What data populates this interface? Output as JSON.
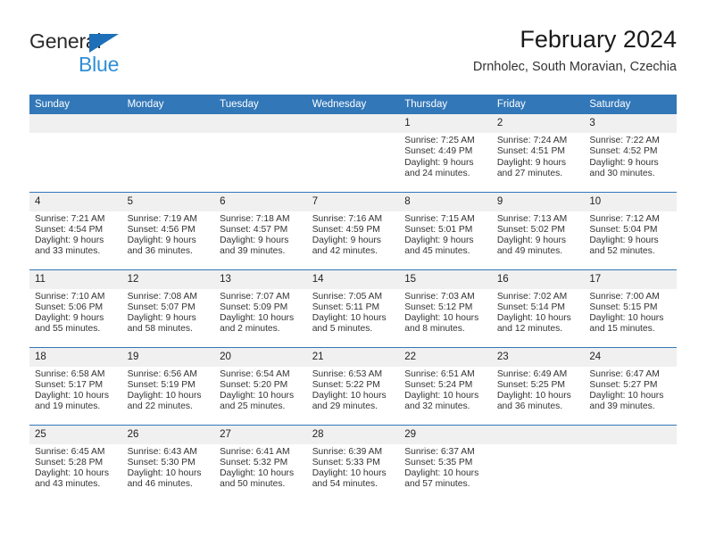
{
  "brand": {
    "name_top": "General",
    "name_bottom": "Blue",
    "triangle_color": "#1d6fb8",
    "text_top_color": "#2b2b2b",
    "text_bottom_color": "#2f8fd8"
  },
  "header": {
    "title": "February 2024",
    "subtitle": "Drnholec, South Moravian, Czechia"
  },
  "theme": {
    "header_blue": "#3277b8",
    "daynum_band": "#f0f0f0",
    "body_text": "#333333"
  },
  "weekdays": [
    "Sunday",
    "Monday",
    "Tuesday",
    "Wednesday",
    "Thursday",
    "Friday",
    "Saturday"
  ],
  "weeks": [
    [
      {
        "day": "",
        "sunrise": "",
        "sunset": "",
        "daylight_line1": "",
        "daylight_line2": ""
      },
      {
        "day": "",
        "sunrise": "",
        "sunset": "",
        "daylight_line1": "",
        "daylight_line2": ""
      },
      {
        "day": "",
        "sunrise": "",
        "sunset": "",
        "daylight_line1": "",
        "daylight_line2": ""
      },
      {
        "day": "",
        "sunrise": "",
        "sunset": "",
        "daylight_line1": "",
        "daylight_line2": ""
      },
      {
        "day": "1",
        "sunrise": "Sunrise: 7:25 AM",
        "sunset": "Sunset: 4:49 PM",
        "daylight_line1": "Daylight: 9 hours",
        "daylight_line2": "and 24 minutes."
      },
      {
        "day": "2",
        "sunrise": "Sunrise: 7:24 AM",
        "sunset": "Sunset: 4:51 PM",
        "daylight_line1": "Daylight: 9 hours",
        "daylight_line2": "and 27 minutes."
      },
      {
        "day": "3",
        "sunrise": "Sunrise: 7:22 AM",
        "sunset": "Sunset: 4:52 PM",
        "daylight_line1": "Daylight: 9 hours",
        "daylight_line2": "and 30 minutes."
      }
    ],
    [
      {
        "day": "4",
        "sunrise": "Sunrise: 7:21 AM",
        "sunset": "Sunset: 4:54 PM",
        "daylight_line1": "Daylight: 9 hours",
        "daylight_line2": "and 33 minutes."
      },
      {
        "day": "5",
        "sunrise": "Sunrise: 7:19 AM",
        "sunset": "Sunset: 4:56 PM",
        "daylight_line1": "Daylight: 9 hours",
        "daylight_line2": "and 36 minutes."
      },
      {
        "day": "6",
        "sunrise": "Sunrise: 7:18 AM",
        "sunset": "Sunset: 4:57 PM",
        "daylight_line1": "Daylight: 9 hours",
        "daylight_line2": "and 39 minutes."
      },
      {
        "day": "7",
        "sunrise": "Sunrise: 7:16 AM",
        "sunset": "Sunset: 4:59 PM",
        "daylight_line1": "Daylight: 9 hours",
        "daylight_line2": "and 42 minutes."
      },
      {
        "day": "8",
        "sunrise": "Sunrise: 7:15 AM",
        "sunset": "Sunset: 5:01 PM",
        "daylight_line1": "Daylight: 9 hours",
        "daylight_line2": "and 45 minutes."
      },
      {
        "day": "9",
        "sunrise": "Sunrise: 7:13 AM",
        "sunset": "Sunset: 5:02 PM",
        "daylight_line1": "Daylight: 9 hours",
        "daylight_line2": "and 49 minutes."
      },
      {
        "day": "10",
        "sunrise": "Sunrise: 7:12 AM",
        "sunset": "Sunset: 5:04 PM",
        "daylight_line1": "Daylight: 9 hours",
        "daylight_line2": "and 52 minutes."
      }
    ],
    [
      {
        "day": "11",
        "sunrise": "Sunrise: 7:10 AM",
        "sunset": "Sunset: 5:06 PM",
        "daylight_line1": "Daylight: 9 hours",
        "daylight_line2": "and 55 minutes."
      },
      {
        "day": "12",
        "sunrise": "Sunrise: 7:08 AM",
        "sunset": "Sunset: 5:07 PM",
        "daylight_line1": "Daylight: 9 hours",
        "daylight_line2": "and 58 minutes."
      },
      {
        "day": "13",
        "sunrise": "Sunrise: 7:07 AM",
        "sunset": "Sunset: 5:09 PM",
        "daylight_line1": "Daylight: 10 hours",
        "daylight_line2": "and 2 minutes."
      },
      {
        "day": "14",
        "sunrise": "Sunrise: 7:05 AM",
        "sunset": "Sunset: 5:11 PM",
        "daylight_line1": "Daylight: 10 hours",
        "daylight_line2": "and 5 minutes."
      },
      {
        "day": "15",
        "sunrise": "Sunrise: 7:03 AM",
        "sunset": "Sunset: 5:12 PM",
        "daylight_line1": "Daylight: 10 hours",
        "daylight_line2": "and 8 minutes."
      },
      {
        "day": "16",
        "sunrise": "Sunrise: 7:02 AM",
        "sunset": "Sunset: 5:14 PM",
        "daylight_line1": "Daylight: 10 hours",
        "daylight_line2": "and 12 minutes."
      },
      {
        "day": "17",
        "sunrise": "Sunrise: 7:00 AM",
        "sunset": "Sunset: 5:15 PM",
        "daylight_line1": "Daylight: 10 hours",
        "daylight_line2": "and 15 minutes."
      }
    ],
    [
      {
        "day": "18",
        "sunrise": "Sunrise: 6:58 AM",
        "sunset": "Sunset: 5:17 PM",
        "daylight_line1": "Daylight: 10 hours",
        "daylight_line2": "and 19 minutes."
      },
      {
        "day": "19",
        "sunrise": "Sunrise: 6:56 AM",
        "sunset": "Sunset: 5:19 PM",
        "daylight_line1": "Daylight: 10 hours",
        "daylight_line2": "and 22 minutes."
      },
      {
        "day": "20",
        "sunrise": "Sunrise: 6:54 AM",
        "sunset": "Sunset: 5:20 PM",
        "daylight_line1": "Daylight: 10 hours",
        "daylight_line2": "and 25 minutes."
      },
      {
        "day": "21",
        "sunrise": "Sunrise: 6:53 AM",
        "sunset": "Sunset: 5:22 PM",
        "daylight_line1": "Daylight: 10 hours",
        "daylight_line2": "and 29 minutes."
      },
      {
        "day": "22",
        "sunrise": "Sunrise: 6:51 AM",
        "sunset": "Sunset: 5:24 PM",
        "daylight_line1": "Daylight: 10 hours",
        "daylight_line2": "and 32 minutes."
      },
      {
        "day": "23",
        "sunrise": "Sunrise: 6:49 AM",
        "sunset": "Sunset: 5:25 PM",
        "daylight_line1": "Daylight: 10 hours",
        "daylight_line2": "and 36 minutes."
      },
      {
        "day": "24",
        "sunrise": "Sunrise: 6:47 AM",
        "sunset": "Sunset: 5:27 PM",
        "daylight_line1": "Daylight: 10 hours",
        "daylight_line2": "and 39 minutes."
      }
    ],
    [
      {
        "day": "25",
        "sunrise": "Sunrise: 6:45 AM",
        "sunset": "Sunset: 5:28 PM",
        "daylight_line1": "Daylight: 10 hours",
        "daylight_line2": "and 43 minutes."
      },
      {
        "day": "26",
        "sunrise": "Sunrise: 6:43 AM",
        "sunset": "Sunset: 5:30 PM",
        "daylight_line1": "Daylight: 10 hours",
        "daylight_line2": "and 46 minutes."
      },
      {
        "day": "27",
        "sunrise": "Sunrise: 6:41 AM",
        "sunset": "Sunset: 5:32 PM",
        "daylight_line1": "Daylight: 10 hours",
        "daylight_line2": "and 50 minutes."
      },
      {
        "day": "28",
        "sunrise": "Sunrise: 6:39 AM",
        "sunset": "Sunset: 5:33 PM",
        "daylight_line1": "Daylight: 10 hours",
        "daylight_line2": "and 54 minutes."
      },
      {
        "day": "29",
        "sunrise": "Sunrise: 6:37 AM",
        "sunset": "Sunset: 5:35 PM",
        "daylight_line1": "Daylight: 10 hours",
        "daylight_line2": "and 57 minutes."
      },
      {
        "day": "",
        "sunrise": "",
        "sunset": "",
        "daylight_line1": "",
        "daylight_line2": ""
      },
      {
        "day": "",
        "sunrise": "",
        "sunset": "",
        "daylight_line1": "",
        "daylight_line2": ""
      }
    ]
  ]
}
